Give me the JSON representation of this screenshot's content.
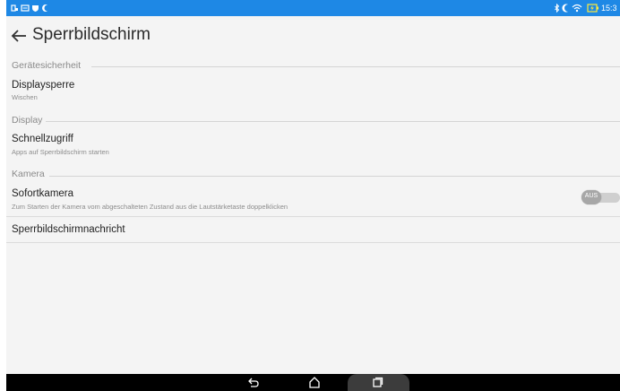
{
  "statusbar": {
    "time": "15:3",
    "left_icons": [
      "notification-icon",
      "message-icon",
      "shield-icon",
      "moon-icon"
    ],
    "right_icons": [
      "bluetooth-icon",
      "moon-icon",
      "wifi-icon",
      "battery-charging-icon"
    ],
    "bg_color": "#1e88e5"
  },
  "header": {
    "title": "Sperrbildschirm"
  },
  "sections": [
    {
      "title": "Gerätesicherheit"
    },
    {
      "title": "Display"
    },
    {
      "title": "Kamera"
    }
  ],
  "rows": {
    "displaysperre": {
      "title": "Displaysperre",
      "subtitle": "Wischen"
    },
    "schnellzugriff": {
      "title": "Schnellzugriff",
      "subtitle": "Apps auf Sperrbildschirm starten"
    },
    "sofortkamera": {
      "title": "Sofortkamera",
      "subtitle": "Zum Starten der Kamera vom abgeschalteten Zustand aus die Lautstärketaste doppelklicken",
      "toggle_label": "AUS"
    },
    "nachricht": {
      "title": "Sperrbildschirmnachricht"
    }
  },
  "navbar": {
    "icons": [
      "back-icon",
      "home-icon",
      "recents-icon"
    ]
  }
}
